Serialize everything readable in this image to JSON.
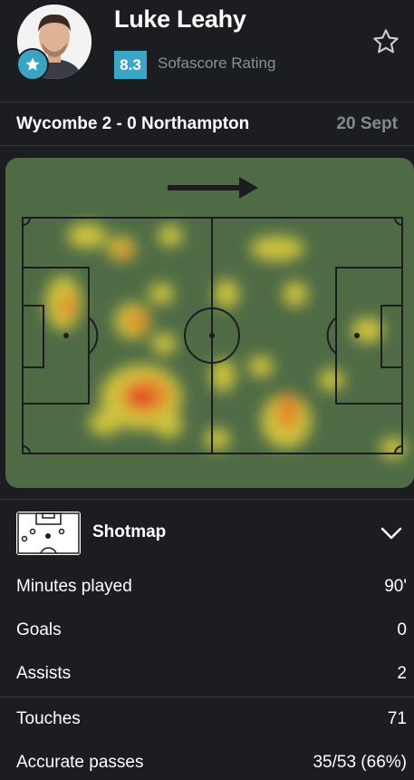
{
  "player": {
    "name": "Luke Leahy",
    "rating": "8.3",
    "rating_label": "Sofascore Rating",
    "rating_color": "#3ba6c6"
  },
  "match": {
    "title": "Wycombe 2 - 0 Northampton",
    "date": "20 Sept"
  },
  "heatmap": {
    "pitch_color": "#4e6b46",
    "direction": "attacking-right"
  },
  "shotmap": {
    "label": "Shotmap",
    "icon": "shotmap-pitch-icon",
    "expand_icon": "chevron-down-icon"
  },
  "stats": {
    "group1": [
      {
        "label": "Minutes played",
        "value": "90'"
      },
      {
        "label": "Goals",
        "value": "0"
      },
      {
        "label": "Assists",
        "value": "2"
      }
    ],
    "group2": [
      {
        "label": "Touches",
        "value": "71"
      },
      {
        "label": "Accurate passes",
        "value": "35/53 (66%)"
      }
    ]
  }
}
